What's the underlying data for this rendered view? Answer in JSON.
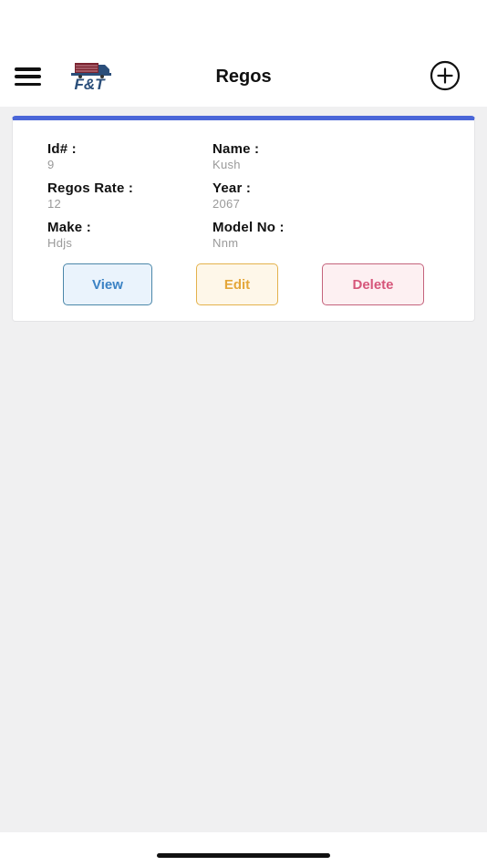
{
  "header": {
    "title": "Regos",
    "logo_text": "F&T"
  },
  "record": {
    "fields": [
      {
        "label": "Id# :",
        "value": "9"
      },
      {
        "label": "Name :",
        "value": "Kush"
      },
      {
        "label": "Regos Rate :",
        "value": "12"
      },
      {
        "label": "Year :",
        "value": "2067"
      },
      {
        "label": "Make :",
        "value": "Hdjs"
      },
      {
        "label": "Model No :",
        "value": "Nnm"
      }
    ],
    "actions": {
      "view_label": "View",
      "edit_label": "Edit",
      "delete_label": "Delete"
    }
  },
  "colors": {
    "card_accent": "#4a66d8",
    "view": "#3b82c4",
    "edit": "#e4a73a",
    "delete": "#d6567a"
  },
  "icons": {
    "menu": "hamburger-menu-icon",
    "add": "plus-circle-icon",
    "logo": "truck-logo"
  }
}
